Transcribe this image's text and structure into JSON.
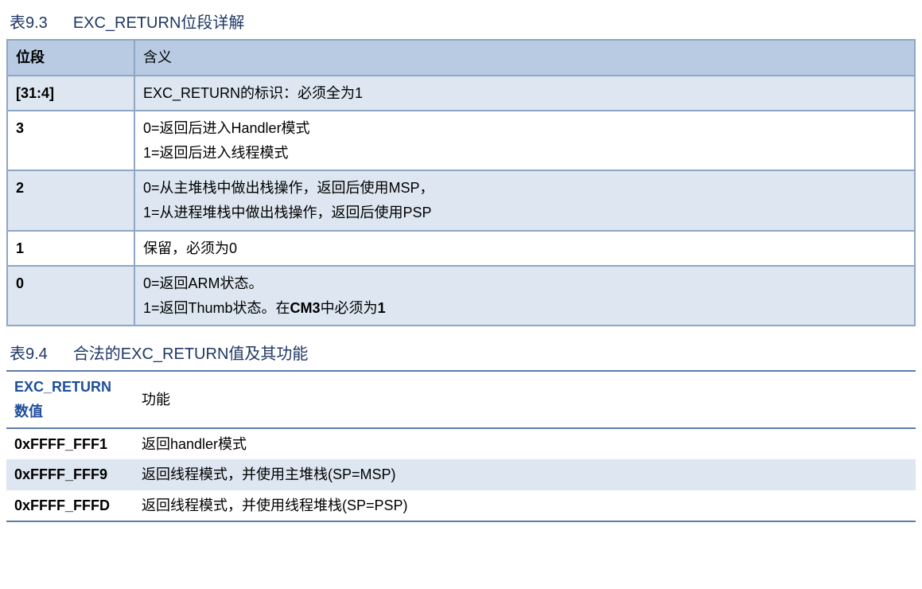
{
  "table1": {
    "caption_num": "表9.3",
    "caption_text": "EXC_RETURN位段详解",
    "headers": {
      "col1": "位段",
      "col2": "含义"
    },
    "rows": [
      {
        "bits": "[31:4]",
        "desc": "EXC_RETURN的标识：必须全为1"
      },
      {
        "bits": "3",
        "desc_line1": "0=返回后进入Handler模式",
        "desc_line2": "1=返回后进入线程模式"
      },
      {
        "bits": "2",
        "desc_line1": "0=从主堆栈中做出栈操作，返回后使用MSP，",
        "desc_line2": "1=从进程堆栈中做出栈操作，返回后使用PSP"
      },
      {
        "bits": "1",
        "desc": "保留，必须为0"
      },
      {
        "bits": "0",
        "desc_line1": "0=返回ARM状态。",
        "desc_line2_pre": "1=返回Thumb状态。在",
        "desc_line2_bold1": "CM3",
        "desc_line2_mid": "中必须为",
        "desc_line2_bold2": "1"
      }
    ]
  },
  "table2": {
    "caption_num": "表9.4",
    "caption_text": "合法的EXC_RETURN值及其功能",
    "headers": {
      "col1_line1": "EXC_RETURN",
      "col1_line2": "数值",
      "col2": "功能"
    },
    "rows": [
      {
        "value": "0xFFFF_FFF1",
        "func": "返回handler模式"
      },
      {
        "value": "0xFFFF_FFF9",
        "func": "返回线程模式，并使用主堆栈(SP=MSP)"
      },
      {
        "value": "0xFFFF_FFFD",
        "func": "返回线程模式，并使用线程堆栈(SP=PSP)"
      }
    ]
  }
}
